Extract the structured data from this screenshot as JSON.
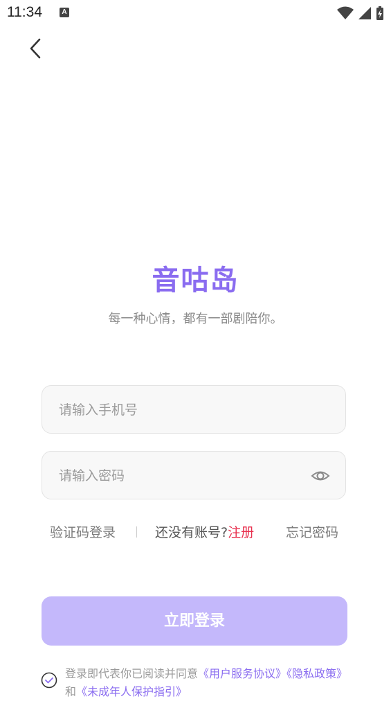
{
  "status": {
    "time": "11:34",
    "notif_letter": "A"
  },
  "brand": {
    "title": "音咕岛",
    "slogan": "每一种心情，都有一部剧陪你。"
  },
  "form": {
    "phone_placeholder": "请输入手机号",
    "password_placeholder": "请输入密码"
  },
  "links": {
    "code_login": "验证码登录",
    "no_account": "还没有账号?",
    "register": "注册",
    "forgot_password": "忘记密码"
  },
  "login_button": "立即登录",
  "agreement": {
    "prefix": "登录即代表你已阅读并同意",
    "user_agreement": "《用户服务协议》",
    "privacy": "《隐私政策》",
    "and": "和",
    "minor": "《未成年人保护指引》"
  },
  "colors": {
    "accent": "#8A6CF0",
    "button": "#C4B8FB",
    "register": "#E8304E"
  },
  "icons": [
    "back-arrow-icon",
    "wifi-icon",
    "signal-icon",
    "battery-icon",
    "eye-icon",
    "check-circle-icon"
  ]
}
